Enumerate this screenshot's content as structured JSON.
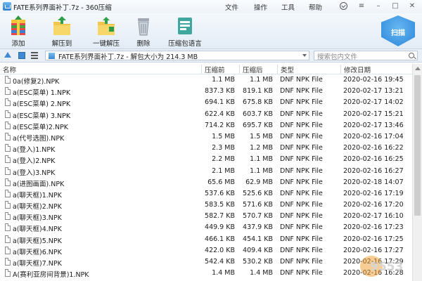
{
  "window": {
    "title": "FATE系列界面补丁.7z - 360压缩",
    "menus": [
      "文件",
      "操作",
      "工具",
      "帮助"
    ]
  },
  "toolbar": {
    "add": "添加",
    "extract": "解压到",
    "one_click": "一键解压",
    "delete": "删除",
    "sfx": "压缩包语言",
    "scan": "扫描"
  },
  "address": {
    "path": "FATE系列界面补丁.7z - 解包大小为 214.3 MB",
    "search_placeholder": "搜索包内文件"
  },
  "columns": {
    "name": "名称",
    "compressed": "压缩前",
    "original": "压缩后",
    "type": "类型",
    "date": "修改日期"
  },
  "files": [
    {
      "name": "0a(修复2).NPK",
      "compressed": "1.1 MB",
      "original": "1.1 MB",
      "type": "DNF NPK File",
      "date": "2020-02-16 19:45"
    },
    {
      "name": "a(ESC菜单) 1.NPK",
      "compressed": "837.3 KB",
      "original": "819.1 KB",
      "type": "DNF NPK File",
      "date": "2020-02-17 13:21"
    },
    {
      "name": "a(ESC菜单) 2.NPK",
      "compressed": "694.1 KB",
      "original": "675.8 KB",
      "type": "DNF NPK File",
      "date": "2020-02-17 14:02"
    },
    {
      "name": "a(ESC菜单) 3.NPK",
      "compressed": "622.4 KB",
      "original": "603.7 KB",
      "type": "DNF NPK File",
      "date": "2020-02-17 15:21"
    },
    {
      "name": "a(ESC菜单)2.NPK",
      "compressed": "714.2 KB",
      "original": "695.7 KB",
      "type": "DNF NPK File",
      "date": "2020-02-17 13:46"
    },
    {
      "name": "a(代号选图).NPK",
      "compressed": "1.5 MB",
      "original": "1.5 MB",
      "type": "DNF NPK File",
      "date": "2020-02-16 17:04"
    },
    {
      "name": "a(登入)1.NPK",
      "compressed": "2.3 MB",
      "original": "1.2 MB",
      "type": "DNF NPK File",
      "date": "2020-02-16 16:22"
    },
    {
      "name": "a(登入)2.NPK",
      "compressed": "2.2 MB",
      "original": "1.1 MB",
      "type": "DNF NPK File",
      "date": "2020-02-16 16:25"
    },
    {
      "name": "a(登入)3.NPK",
      "compressed": "2.1 MB",
      "original": "1.1 MB",
      "type": "DNF NPK File",
      "date": "2020-02-16 16:27"
    },
    {
      "name": "a(进图画面).NPK",
      "compressed": "65.6 MB",
      "original": "62.9 MB",
      "type": "DNF NPK File",
      "date": "2020-02-18 14:07"
    },
    {
      "name": "a(聊天框)1.NPK",
      "compressed": "537.6 KB",
      "original": "525.6 KB",
      "type": "DNF NPK File",
      "date": "2020-02-16 17:19"
    },
    {
      "name": "a(聊天框)2.NPK",
      "compressed": "583.5 KB",
      "original": "571.6 KB",
      "type": "DNF NPK File",
      "date": "2020-02-16 17:20"
    },
    {
      "name": "a(聊天框)3.NPK",
      "compressed": "582.7 KB",
      "original": "570.7 KB",
      "type": "DNF NPK File",
      "date": "2020-02-17 16:10"
    },
    {
      "name": "a(聊天框)4.NPK",
      "compressed": "449.9 KB",
      "original": "437.9 KB",
      "type": "DNF NPK File",
      "date": "2020-02-16 17:23"
    },
    {
      "name": "a(聊天框)5.NPK",
      "compressed": "466.1 KB",
      "original": "454.1 KB",
      "type": "DNF NPK File",
      "date": "2020-02-16 17:25"
    },
    {
      "name": "a(聊天框)6.NPK",
      "compressed": "422.0 KB",
      "original": "409.4 KB",
      "type": "DNF NPK File",
      "date": "2020-02-16 17:27"
    },
    {
      "name": "a(聊天框)7.NPK",
      "compressed": "542.4 KB",
      "original": "530.2 KB",
      "type": "DNF NPK File",
      "date": "2020-02-16 17:29"
    },
    {
      "name": "A(赛利亚房间背景)1.NPK",
      "compressed": "1.4 MB",
      "original": "1.4 MB",
      "type": "DNF NPK File",
      "date": "2020-02-16 16:28"
    }
  ],
  "watermark": "9553"
}
